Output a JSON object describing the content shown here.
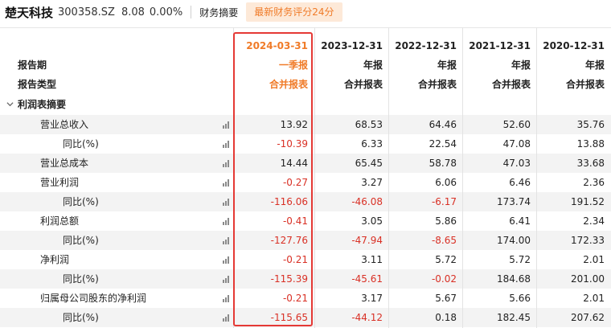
{
  "stock": {
    "name": "楚天科技",
    "code": "300358.SZ",
    "price": "8.08",
    "change": "0.00%",
    "tab": "财务摘要",
    "score_button": "最新财务评分24分"
  },
  "header": {
    "period_label": "报告期",
    "type_label": "报告类型",
    "dates": [
      "2024-03-31",
      "2023-12-31",
      "2022-12-31",
      "2021-12-31",
      "2020-12-31"
    ],
    "periods": [
      "一季报",
      "年报",
      "年报",
      "年报",
      "年报"
    ],
    "types": [
      "合并报表",
      "合并报表",
      "合并报表",
      "合并报表",
      "合并报表"
    ]
  },
  "section": {
    "title": "利润表摘要",
    "chevron_icon": "chevron-down-icon"
  },
  "rows": [
    {
      "label": "营业总收入",
      "values": [
        "13.92",
        "68.53",
        "64.46",
        "52.60",
        "35.76"
      ]
    },
    {
      "label": "同比(%)",
      "values": [
        "-10.39",
        "6.33",
        "22.54",
        "47.08",
        "13.88"
      ]
    },
    {
      "label": "营业总成本",
      "values": [
        "14.44",
        "65.45",
        "58.78",
        "47.03",
        "33.68"
      ]
    },
    {
      "label": "营业利润",
      "values": [
        "-0.27",
        "3.27",
        "6.06",
        "6.46",
        "2.36"
      ]
    },
    {
      "label": "同比(%)",
      "values": [
        "-116.06",
        "-46.08",
        "-6.17",
        "173.74",
        "191.52"
      ]
    },
    {
      "label": "利润总额",
      "values": [
        "-0.41",
        "3.05",
        "5.86",
        "6.41",
        "2.34"
      ]
    },
    {
      "label": "同比(%)",
      "values": [
        "-127.76",
        "-47.94",
        "-8.65",
        "174.00",
        "172.33"
      ]
    },
    {
      "label": "净利润",
      "values": [
        "-0.21",
        "3.11",
        "5.72",
        "5.72",
        "2.01"
      ]
    },
    {
      "label": "同比(%)",
      "values": [
        "-115.39",
        "-45.61",
        "-0.02",
        "184.68",
        "201.00"
      ]
    },
    {
      "label": "归属母公司股东的净利润",
      "values": [
        "-0.21",
        "3.17",
        "5.67",
        "5.66",
        "2.01"
      ]
    },
    {
      "label": "同比(%)",
      "values": [
        "-115.65",
        "-44.12",
        "0.18",
        "182.45",
        "207.62"
      ]
    }
  ],
  "colors": {
    "accent": "#f07b28",
    "negative": "#d93025",
    "highlight_box": "#e53935",
    "stripe": "#f3f3f3"
  }
}
